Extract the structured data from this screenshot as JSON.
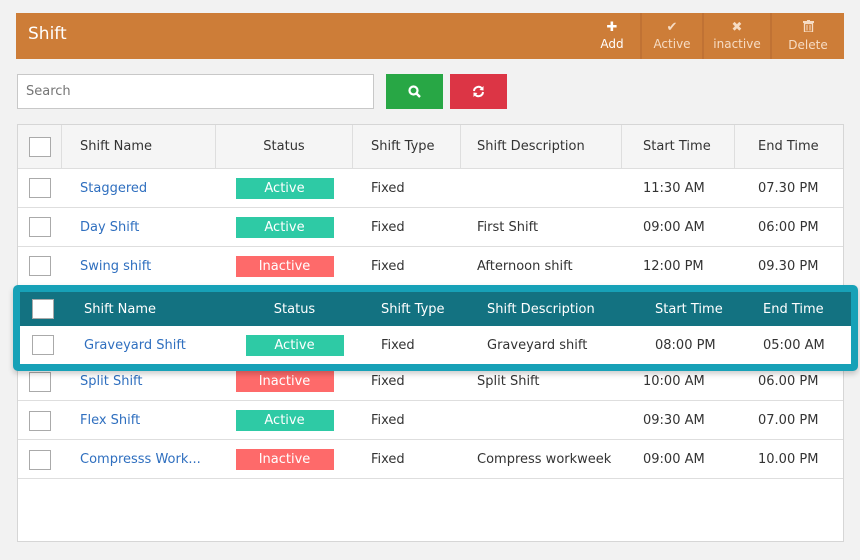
{
  "header": {
    "title": "Shift",
    "actions": [
      {
        "label": "Add",
        "icon": "plus-icon",
        "glyph": "✚"
      },
      {
        "label": "Active",
        "icon": "check-icon",
        "glyph": "✔"
      },
      {
        "label": "inactive",
        "icon": "times-icon",
        "glyph": "✖"
      },
      {
        "label": "Delete",
        "icon": "trash-icon",
        "glyph": "🗑"
      }
    ]
  },
  "search": {
    "placeholder": "Search",
    "value": ""
  },
  "buttons": {
    "search_icon": "search-icon",
    "reset_icon": "refresh-icon"
  },
  "colors": {
    "header": "#cd7d38",
    "search_btn": "#28a745",
    "reset_btn": "#dc3545",
    "active": "#2ecaa5",
    "inactive": "#fe6a6a",
    "highlight": "#17a1b7",
    "highlight_head": "#137281",
    "link": "#2f6fbf"
  },
  "table": {
    "columns": [
      "Shift Name",
      "Status",
      "Shift Type",
      "Shift Description",
      "Start Time",
      "End Time"
    ],
    "rows": [
      {
        "name": "Staggered",
        "status": "Active",
        "type": "Fixed",
        "description": "",
        "start": "11:30 AM",
        "end": "07.30 PM"
      },
      {
        "name": "Day Shift",
        "status": "Active",
        "type": "Fixed",
        "description": "First Shift",
        "start": "09:00 AM",
        "end": "06:00 PM"
      },
      {
        "name": "Swing shift",
        "status": "Inactive",
        "type": "Fixed",
        "description": "Afternoon shift",
        "start": "12:00 PM",
        "end": "09.30 PM"
      },
      {
        "name": "Graveyard Shift",
        "status": "Active",
        "type": "Fixed",
        "description": "Graveyard shift",
        "start": "08:00 PM",
        "end": "05:00 AM"
      },
      {
        "name": "Split Shift",
        "status": "Inactive",
        "type": "Fixed",
        "description": "Split Shift",
        "start": "10:00 AM",
        "end": "06.00 PM"
      },
      {
        "name": "Flex Shift",
        "status": "Active",
        "type": "Fixed",
        "description": "",
        "start": "09:30 AM",
        "end": "07.00 PM"
      },
      {
        "name": "Compresss Work...",
        "status": "Inactive",
        "type": "Fixed",
        "description": "Compress workweek",
        "start": "09:00 AM",
        "end": "10.00 PM"
      }
    ]
  },
  "highlight": {
    "row_index": 3
  }
}
